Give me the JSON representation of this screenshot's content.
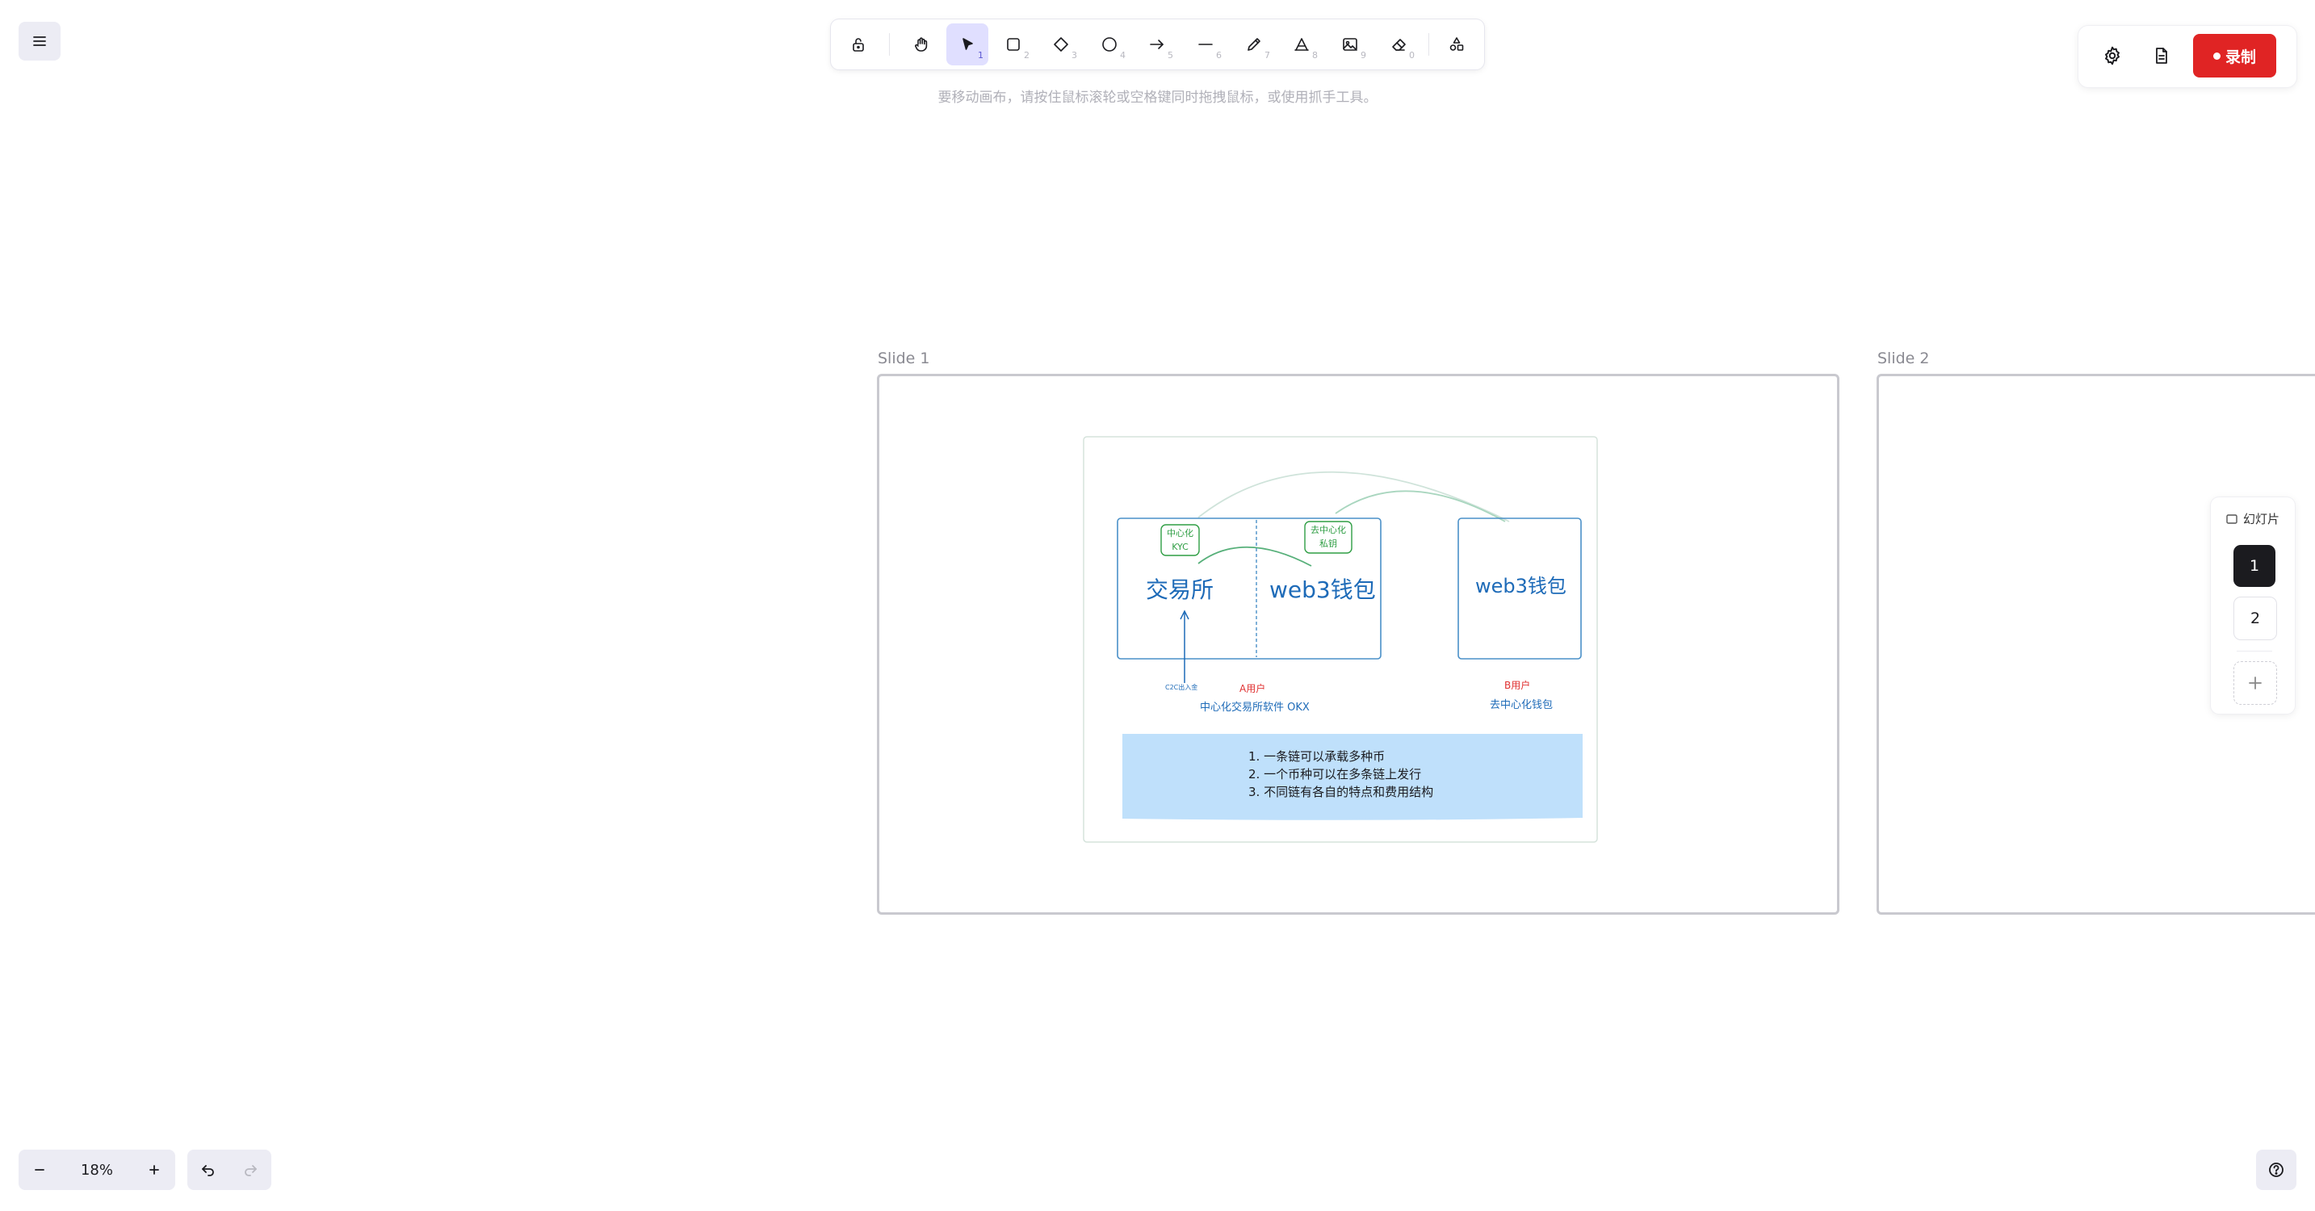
{
  "canvas_hint": "要移动画布，请按住鼠标滚轮或空格键同时拖拽鼠标，或使用抓手工具。",
  "toolbar": {
    "tools": [
      {
        "name": "selection",
        "key": "1"
      },
      {
        "name": "rectangle",
        "key": "2"
      },
      {
        "name": "diamond",
        "key": "3"
      },
      {
        "name": "ellipse",
        "key": "4"
      },
      {
        "name": "arrow",
        "key": "5"
      },
      {
        "name": "line",
        "key": "6"
      },
      {
        "name": "draw",
        "key": "7"
      },
      {
        "name": "text",
        "key": "8"
      },
      {
        "name": "image",
        "key": "9"
      },
      {
        "name": "eraser",
        "key": "0"
      }
    ]
  },
  "record_button": "录制",
  "slides": {
    "labels": [
      "Slide 1",
      "Slide 2"
    ],
    "panel_title": "幻灯片",
    "numbers": [
      "1",
      "2"
    ],
    "active": "1"
  },
  "slide1": {
    "tag_kyc_1": "中心化",
    "tag_kyc_2": "KYC",
    "tag_key_1": "去中心化",
    "tag_key_2": "私钥",
    "exchange": "交易所",
    "wallet_a": "web3钱包",
    "wallet_b": "web3钱包",
    "c2c_note": "C2C出入金",
    "user_a": "A用户",
    "caption_a": "中心化交易所软件 OKX",
    "user_b": "B用户",
    "caption_b": "去中心化钱包",
    "notes": [
      "1. 一条链可以承载多种币",
      "2. 一个币种可以在多条链上发行",
      "3. 不同链有各自的特点和费用结构"
    ]
  },
  "zoom": {
    "level": "18%"
  },
  "colors": {
    "accent": "#e0dfff",
    "record": "#e02424",
    "diagram_blue": "#1e6bb8",
    "diagram_green": "#2f9e44",
    "note_fill": "#bfe0fb",
    "user_red": "#e03131"
  }
}
